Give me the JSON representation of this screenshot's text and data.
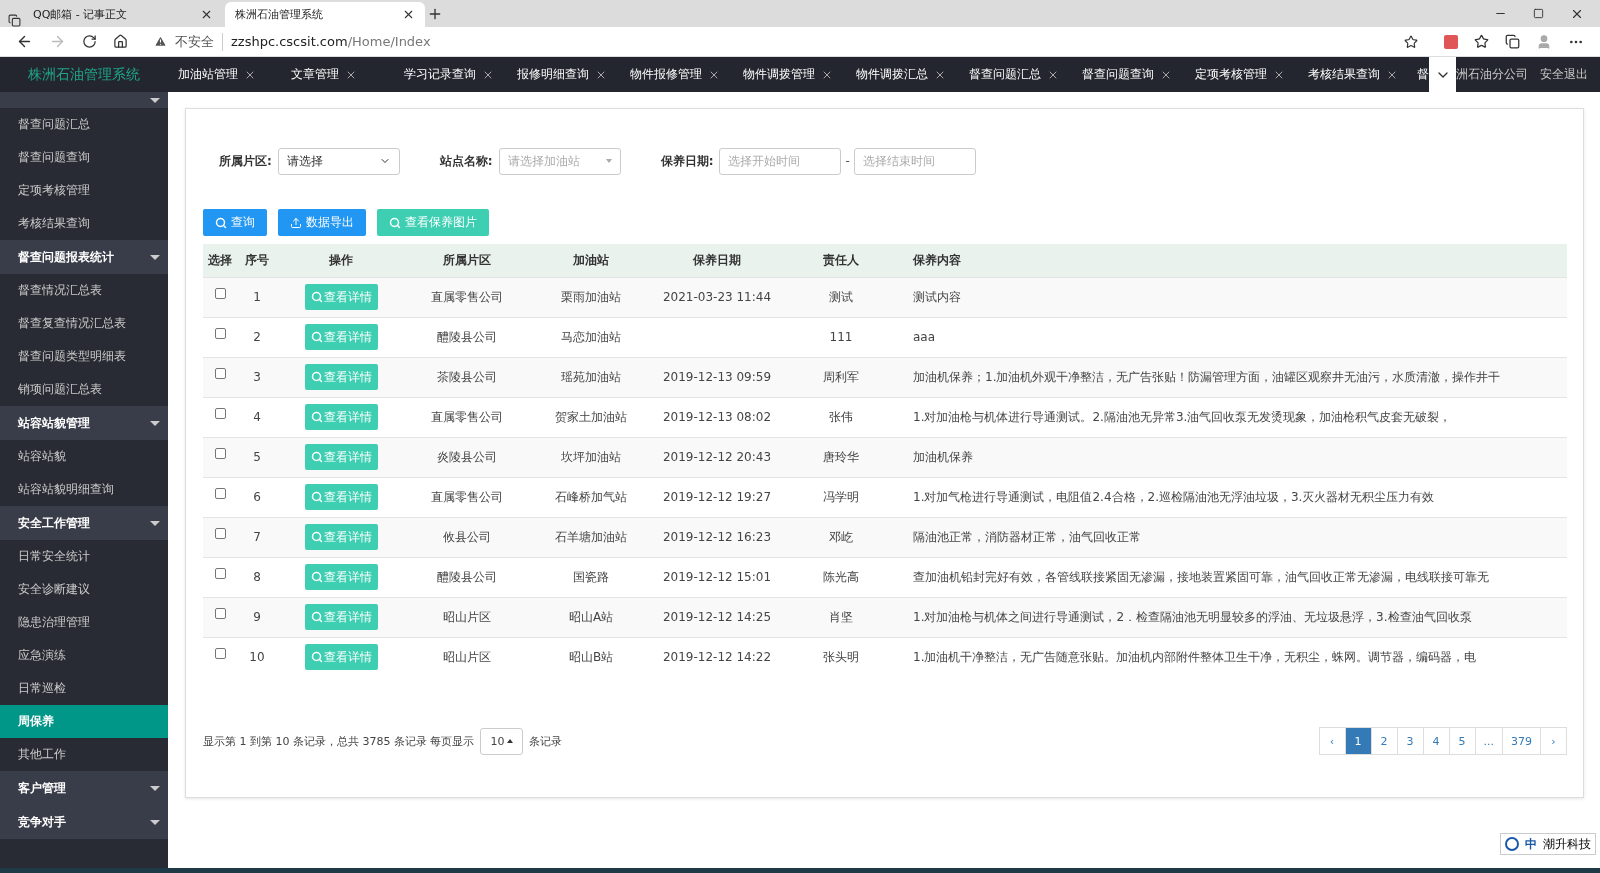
{
  "browser": {
    "tabs": [
      {
        "title": "QQ邮箱 - 记事正文",
        "selected": false
      },
      {
        "title": "株洲石油管理系统",
        "selected": true
      }
    ],
    "security": "不安全",
    "url_host": "zzshpc.cscsit.com",
    "url_path": "/Home/Index"
  },
  "header": {
    "brand": "株洲石油管理系统",
    "tabs": [
      "加油站管理",
      "文章管理",
      "学习记录查询",
      "报修明细查询",
      "物件报修管理",
      "物件调拨管理",
      "物件调拨汇总",
      "督查问题汇总",
      "督查问题查询",
      "定项考核管理",
      "考核结果查询"
    ],
    "cut_tab": "督",
    "company": "洲石油分公司",
    "logout": "安全退出"
  },
  "sidebar": [
    {
      "kind": "group"
    },
    {
      "kind": "item",
      "label": "督查问题汇总",
      "selected": false
    },
    {
      "kind": "item",
      "label": "督查问题查询",
      "selected": false
    },
    {
      "kind": "item",
      "label": "定项考核管理",
      "selected": false
    },
    {
      "kind": "item",
      "label": "考核结果查询",
      "selected": false
    },
    {
      "kind": "group",
      "label": "督查问题报表统计"
    },
    {
      "kind": "item",
      "label": "督查情况汇总表",
      "selected": false
    },
    {
      "kind": "item",
      "label": "督查复查情况汇总表",
      "selected": false
    },
    {
      "kind": "item",
      "label": "督查问题类型明细表",
      "selected": false
    },
    {
      "kind": "item",
      "label": "销项问题汇总表",
      "selected": false
    },
    {
      "kind": "group",
      "label": "站容站貌管理"
    },
    {
      "kind": "item",
      "label": "站容站貌",
      "selected": false
    },
    {
      "kind": "item",
      "label": "站容站貌明细查询",
      "selected": false
    },
    {
      "kind": "group",
      "label": "安全工作管理"
    },
    {
      "kind": "item",
      "label": "日常安全统计",
      "selected": false
    },
    {
      "kind": "item",
      "label": "安全诊断建议",
      "selected": false
    },
    {
      "kind": "item",
      "label": "隐患治理管理",
      "selected": false
    },
    {
      "kind": "item",
      "label": "应急演练",
      "selected": false
    },
    {
      "kind": "item",
      "label": "日常巡检",
      "selected": false
    },
    {
      "kind": "item",
      "label": "周保养",
      "selected": true
    },
    {
      "kind": "item",
      "label": "其他工作",
      "selected": false
    },
    {
      "kind": "group",
      "label": "客户管理"
    },
    {
      "kind": "group",
      "label": "竞争对手"
    }
  ],
  "filters": {
    "area_label": "所属片区:",
    "area_value": "请选择",
    "station_label": "站点名称:",
    "station_placeholder": "请选择加油站",
    "date_label": "保养日期:",
    "start_placeholder": "选择开始时间",
    "dash": "-",
    "end_placeholder": "选择结束时间"
  },
  "buttons": [
    {
      "kind": "primary",
      "label": "查询"
    },
    {
      "kind": "primary",
      "label": "数据导出"
    },
    {
      "kind": "teal",
      "label": "查看保养图片"
    }
  ],
  "table": {
    "columns": [
      "选择",
      "序号",
      "操作",
      "所属片区",
      "加油站",
      "保养日期",
      "责任人",
      "保养内容"
    ],
    "rows": [
      {
        "action": "查看详情",
        "checked": false,
        "no": "1",
        "area": "直属零售公司",
        "station": "栗雨加油站",
        "date": "2021-03-23 11:44",
        "person": "测试",
        "content": "测试内容"
      },
      {
        "action": "查看详情",
        "checked": false,
        "no": "2",
        "area": "醴陵县公司",
        "station": "马恋加油站",
        "date": "",
        "person": "111",
        "content": "aaa"
      },
      {
        "action": "查看详情",
        "checked": false,
        "no": "3",
        "area": "茶陵县公司",
        "station": "瑶苑加油站",
        "date": "2019-12-13 09:59",
        "person": "周利军",
        "content": "加油机保养；1.加油机外观干净整洁，无广告张贴！防漏管理方面，油罐区观察井无油污，水质清澈，操作井干"
      },
      {
        "action": "查看详情",
        "checked": false,
        "no": "4",
        "area": "直属零售公司",
        "station": "贺家土加油站",
        "date": "2019-12-13 08:02",
        "person": "张伟",
        "content": "1.对加油枪与机体进行导通测试。2.隔油池无异常3.油气回收泵无发烫现象，加油枪积气皮套无破裂，"
      },
      {
        "action": "查看详情",
        "checked": false,
        "no": "5",
        "area": "炎陵县公司",
        "station": "坎坪加油站",
        "date": "2019-12-12 20:43",
        "person": "唐玲华",
        "content": "加油机保养"
      },
      {
        "action": "查看详情",
        "checked": false,
        "no": "6",
        "area": "直属零售公司",
        "station": "石峰桥加气站",
        "date": "2019-12-12 19:27",
        "person": "冯学明",
        "content": "1.对加气枪进行导通测试，电阻值2.4合格，2.巡检隔油池无浮油垃圾，3.灭火器材无积尘压力有效"
      },
      {
        "action": "查看详情",
        "checked": false,
        "no": "7",
        "area": "攸县公司",
        "station": "石羊塘加油站",
        "date": "2019-12-12 16:23",
        "person": "邓屹",
        "content": "隔油池正常，消防器材正常，油气回收正常"
      },
      {
        "action": "查看详情",
        "checked": false,
        "no": "8",
        "area": "醴陵县公司",
        "station": "国瓷路",
        "date": "2019-12-12 15:01",
        "person": "陈光高",
        "content": "查加油机铅封完好有效，各管线联接紧固无渗漏，接地装置紧固可靠，油气回收正常无渗漏，电线联接可靠无"
      },
      {
        "action": "查看详情",
        "checked": false,
        "no": "9",
        "area": "昭山片区",
        "station": "昭山A站",
        "date": "2019-12-12 14:25",
        "person": "肖坚",
        "content": "1.对加油枪与机体之间进行导通测试，2．检查隔油池无明显较多的浮油、无垃圾悬浮，3.检查油气回收泵"
      },
      {
        "action": "查看详情",
        "checked": false,
        "no": "10",
        "area": "昭山片区",
        "station": "昭山B站",
        "date": "2019-12-12 14:22",
        "person": "张头明",
        "content": "1.加油机干净整洁，无广告随意张贴。加油机内部附件整体卫生干净，无积尘，蛛网。调节器，编码器，电"
      }
    ]
  },
  "footer": {
    "summary": "显示第 1 到第 10 条记录，总共 3785 条记录 每页显示",
    "page_size": "10",
    "suffix": "条记录",
    "pages": [
      {
        "label": "‹",
        "selected": false
      },
      {
        "label": "1",
        "selected": true
      },
      {
        "label": "2",
        "selected": false
      },
      {
        "label": "3",
        "selected": false
      },
      {
        "label": "4",
        "selected": false
      },
      {
        "label": "5",
        "selected": false
      },
      {
        "label": "...",
        "selected": false
      },
      {
        "label": "379",
        "selected": false
      },
      {
        "label": "›",
        "selected": false
      }
    ]
  },
  "ime": {
    "lang": "中",
    "brand": "潮升科技"
  }
}
